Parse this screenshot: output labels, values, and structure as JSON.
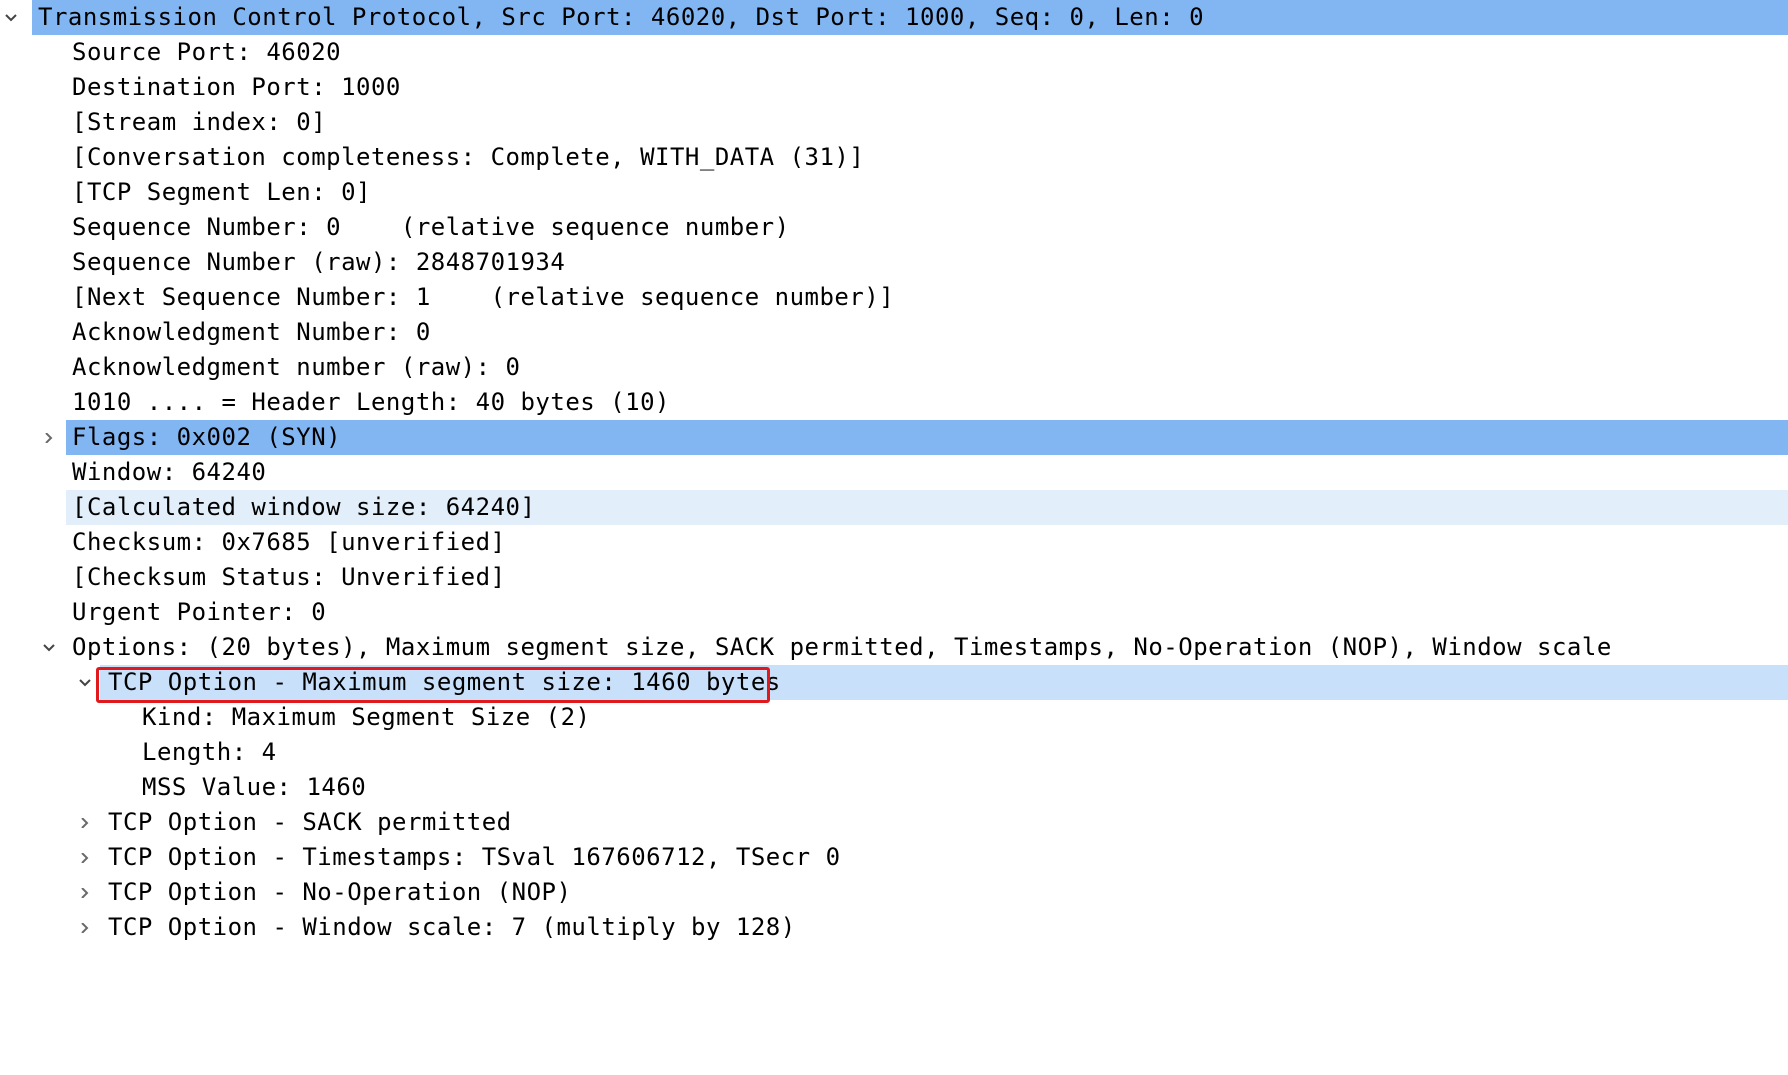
{
  "packet_details": {
    "tcp_header": {
      "label": "Transmission Control Protocol, Src Port: 46020, Dst Port: 1000, Seq: 0, Len: 0",
      "expanded": true
    },
    "fields": [
      "Source Port: 46020",
      "Destination Port: 1000",
      "[Stream index: 0]",
      "[Conversation completeness: Complete, WITH_DATA (31)]",
      "[TCP Segment Len: 0]",
      "Sequence Number: 0    (relative sequence number)",
      "Sequence Number (raw): 2848701934",
      "[Next Sequence Number: 1    (relative sequence number)]",
      "Acknowledgment Number: 0",
      "Acknowledgment number (raw): 0",
      "1010 .... = Header Length: 40 bytes (10)"
    ],
    "flags": {
      "label": "Flags: 0x002 (SYN)",
      "expanded": false
    },
    "fields_after_flags": [
      "Window: 64240",
      "[Calculated window size: 64240]",
      "Checksum: 0x7685 [unverified]",
      "[Checksum Status: Unverified]",
      "Urgent Pointer: 0"
    ],
    "options": {
      "label": "Options: (20 bytes), Maximum segment size, SACK permitted, Timestamps, No-Operation (NOP), Window scale",
      "expanded": true,
      "mss": {
        "label": "TCP Option - Maximum segment size: 1460 bytes",
        "expanded": true,
        "fields": [
          "Kind: Maximum Segment Size (2)",
          "Length: 4",
          "MSS Value: 1460"
        ]
      },
      "collapsed": [
        "TCP Option - SACK permitted",
        "TCP Option - Timestamps: TSval 167606712, TSecr 0",
        "TCP Option - No-Operation (NOP)",
        "TCP Option - Window scale: 7 (multiply by 128)"
      ]
    }
  },
  "colors": {
    "selected_row": "#82b6f2",
    "hover_row": "#c8e0fa",
    "light_row": "#e2effb",
    "highlight_box": "#e0191d"
  }
}
